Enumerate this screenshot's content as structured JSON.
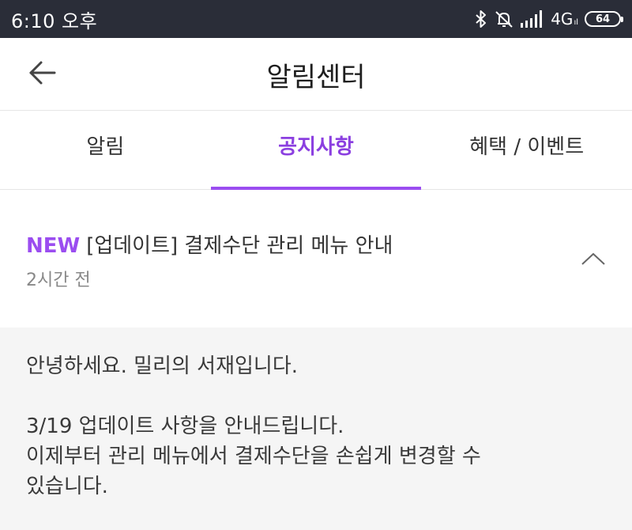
{
  "status_bar": {
    "time": "6:10 오후",
    "network": "4G",
    "network_sub": "ıl",
    "battery": "64",
    "icons": [
      "bluetooth-icon",
      "mute-icon",
      "signal-icon"
    ]
  },
  "header": {
    "back_icon": "arrow-left-icon",
    "title": "알림센터"
  },
  "tabs": [
    {
      "label": "알림",
      "active": false
    },
    {
      "label": "공지사항",
      "active": true
    },
    {
      "label": "혜택 / 이벤트",
      "active": false
    }
  ],
  "notice": {
    "badge": "NEW",
    "title": "[업데이트] 결제수단 관리 메뉴 안내",
    "time": "2시간 전",
    "expanded": true
  },
  "content": {
    "line1": "안녕하세요. 밀리의 서재입니다.",
    "line2": "3/19 업데이트 사항을 안내드립니다.",
    "line3": "이제부터 관리 메뉴에서 결제수단을 손쉽게 변경할 수",
    "line4": "있습니다."
  },
  "colors": {
    "accent": "#9b4df0",
    "status_bar": "#2a2d38",
    "content_bg": "#f5f5f5"
  }
}
